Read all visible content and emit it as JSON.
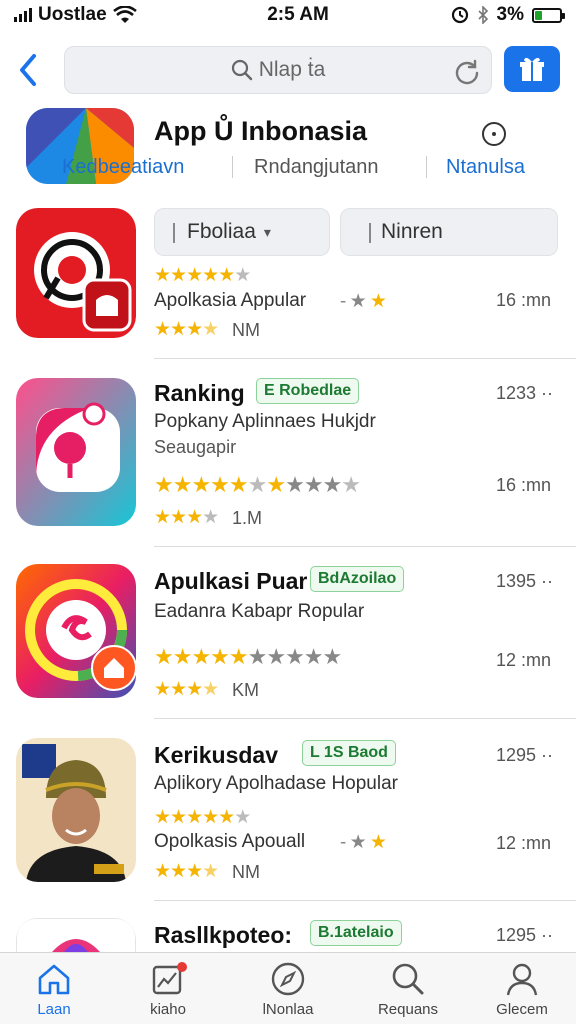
{
  "status_bar": {
    "carrier": "Uostlae",
    "time": "2:5 AM",
    "battery": "3%"
  },
  "search": {
    "placeholder": "Nlap ṫa"
  },
  "header": {
    "title": "App Ů Inbonasia",
    "tabs": [
      "Kedbeeatiavn",
      "Rndangjutann",
      "Ntanulsa"
    ]
  },
  "filters": {
    "sort": "Fboliaa",
    "category": "Ninren"
  },
  "apps": [
    {
      "name": "",
      "badge": "",
      "subtitle": "",
      "desc": "",
      "rating_stars": 4.5,
      "desc2": "Apolkasia Appular",
      "small_rating_stars": 3.5,
      "small_label": "NM",
      "size": "16 :mn",
      "count": ""
    },
    {
      "name": "Ranking",
      "badge": "E Robedlae",
      "subtitle": "Popkany Aplinnaes Hukjdr",
      "desc": "Seaugapir",
      "rating_stars": 6,
      "small_rating_stars": 3,
      "small_label": "1.M",
      "size": "16 :mn",
      "count": "1233 ··"
    },
    {
      "name": "Apulkasi Puar",
      "badge": "BdAzoilao",
      "subtitle": "Eadanra Kabapr Ropular",
      "desc": "",
      "rating_stars": 5,
      "small_rating_stars": 3.5,
      "small_label": "KM",
      "size": "12 :mn",
      "count": "1395 ··"
    },
    {
      "name": "Kerikusdav",
      "badge": "L 1S Baod",
      "subtitle": "Aplikory Apolhadase Hopular",
      "desc": "",
      "rating_stars": 4.5,
      "desc2": "Opolkasis Apouall",
      "small_rating_stars": 3.5,
      "small_label": "NM",
      "size": "12 :mn",
      "count": "1295 ··"
    },
    {
      "name": "Rasllkpoteo:",
      "badge": "B.1atelaio",
      "count": "1295 ··"
    }
  ],
  "tabbar": [
    {
      "label": "Laan",
      "icon": "home-icon"
    },
    {
      "label": "kiaho",
      "icon": "news-icon"
    },
    {
      "label": "lNonlaa",
      "icon": "compass-icon"
    },
    {
      "label": "Requans",
      "icon": "search-icon"
    },
    {
      "label": "Glecem",
      "icon": "profile-icon"
    }
  ],
  "colors": {
    "accent": "#1a73e8",
    "star": "#f5b400",
    "badge_green": "#1c7a32"
  }
}
